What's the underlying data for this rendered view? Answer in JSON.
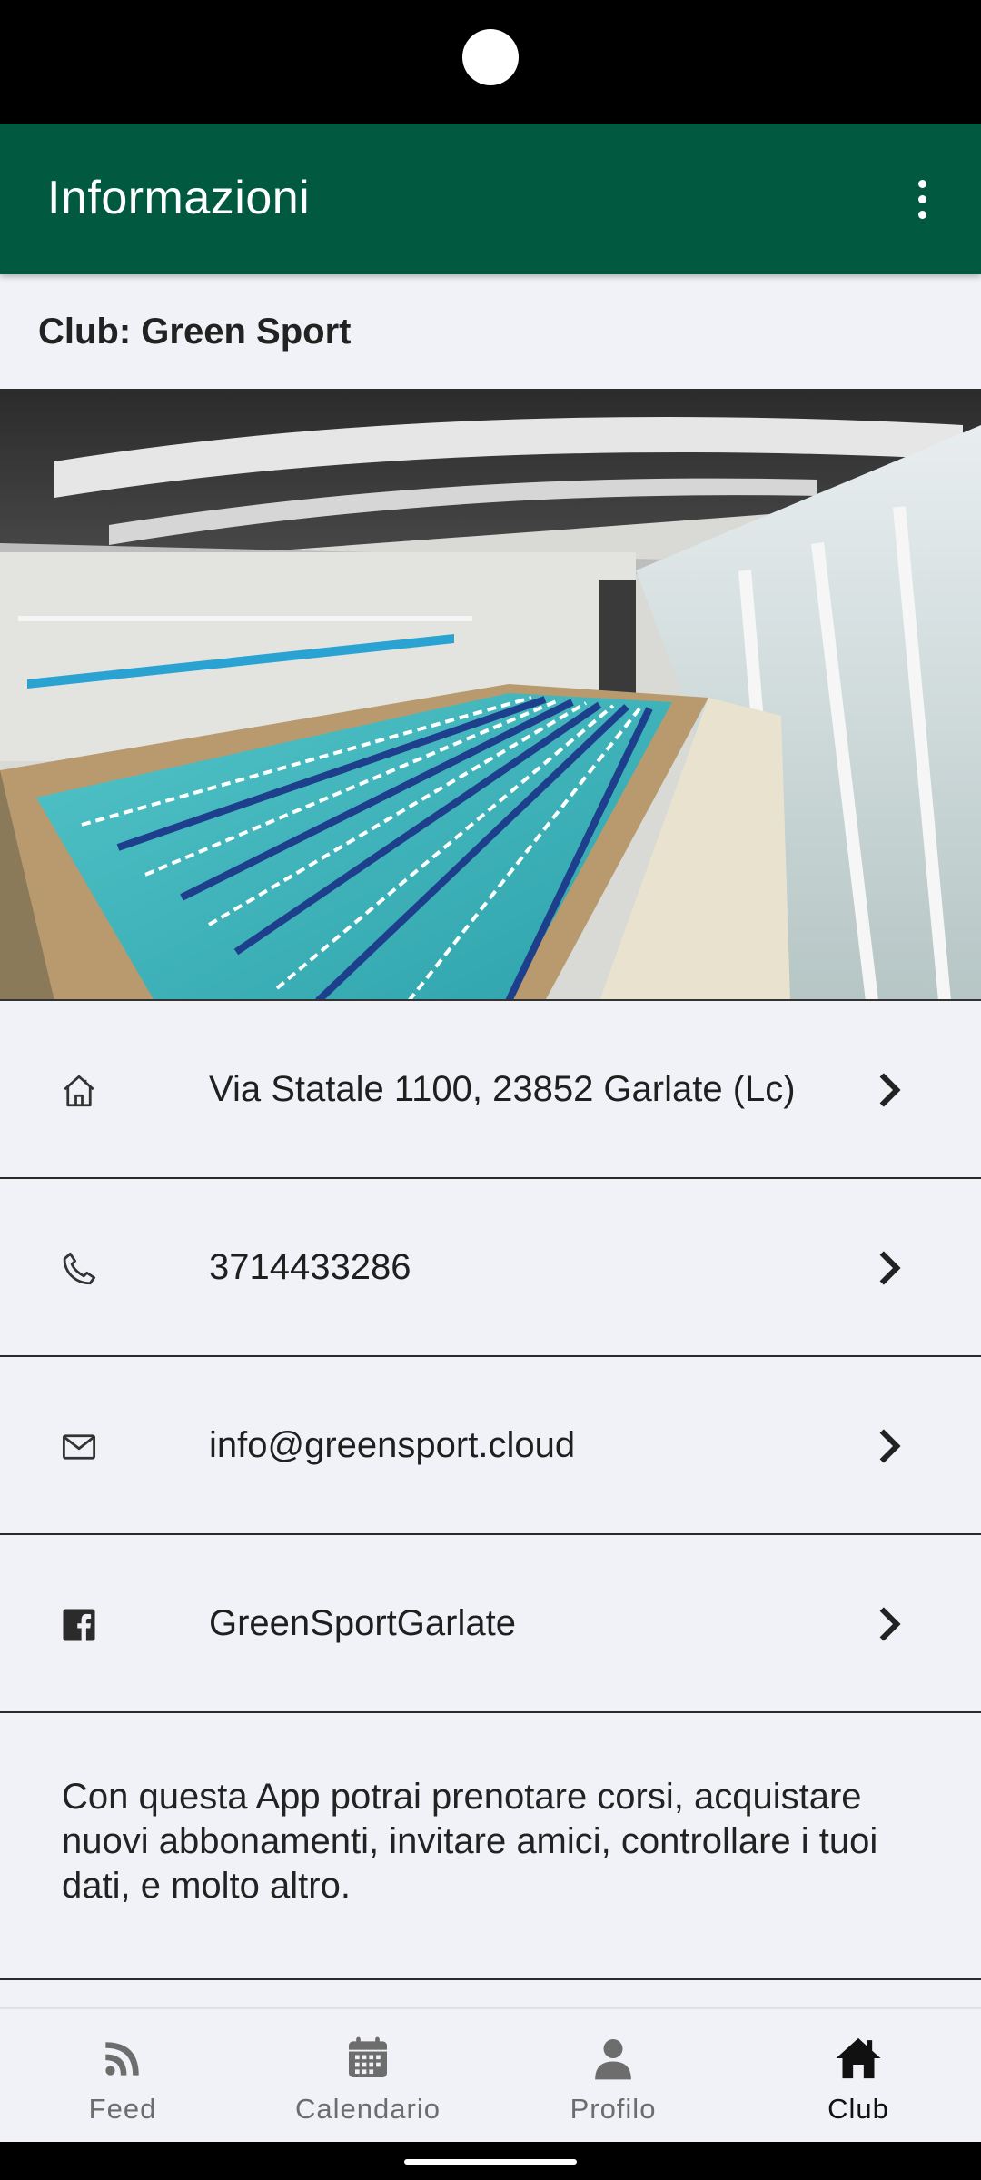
{
  "appbar": {
    "title": "Informazioni",
    "menu_icon": "more-vert-icon",
    "color": "#015a40"
  },
  "club": {
    "label": "Club: Green Sport"
  },
  "info_rows": [
    {
      "icon": "home-icon",
      "text": "Via Statale 1100, 23852 Garlate (Lc)"
    },
    {
      "icon": "phone-icon",
      "text": "3714433286"
    },
    {
      "icon": "mail-icon",
      "text": "info@greensport.cloud"
    },
    {
      "icon": "facebook-icon",
      "text": "GreenSportGarlate"
    }
  ],
  "description": "Con questa App potrai prenotare corsi, acquistare nuovi abbonamenti, invitare amici, controllare i tuoi dati, e molto altro.",
  "bottom_nav": [
    {
      "label": "Feed",
      "icon": "rss-feed-icon",
      "active": false
    },
    {
      "label": "Calendario",
      "icon": "calendar-icon",
      "active": false
    },
    {
      "label": "Profilo",
      "icon": "person-icon",
      "active": false
    },
    {
      "label": "Club",
      "icon": "home-icon",
      "active": true
    }
  ]
}
